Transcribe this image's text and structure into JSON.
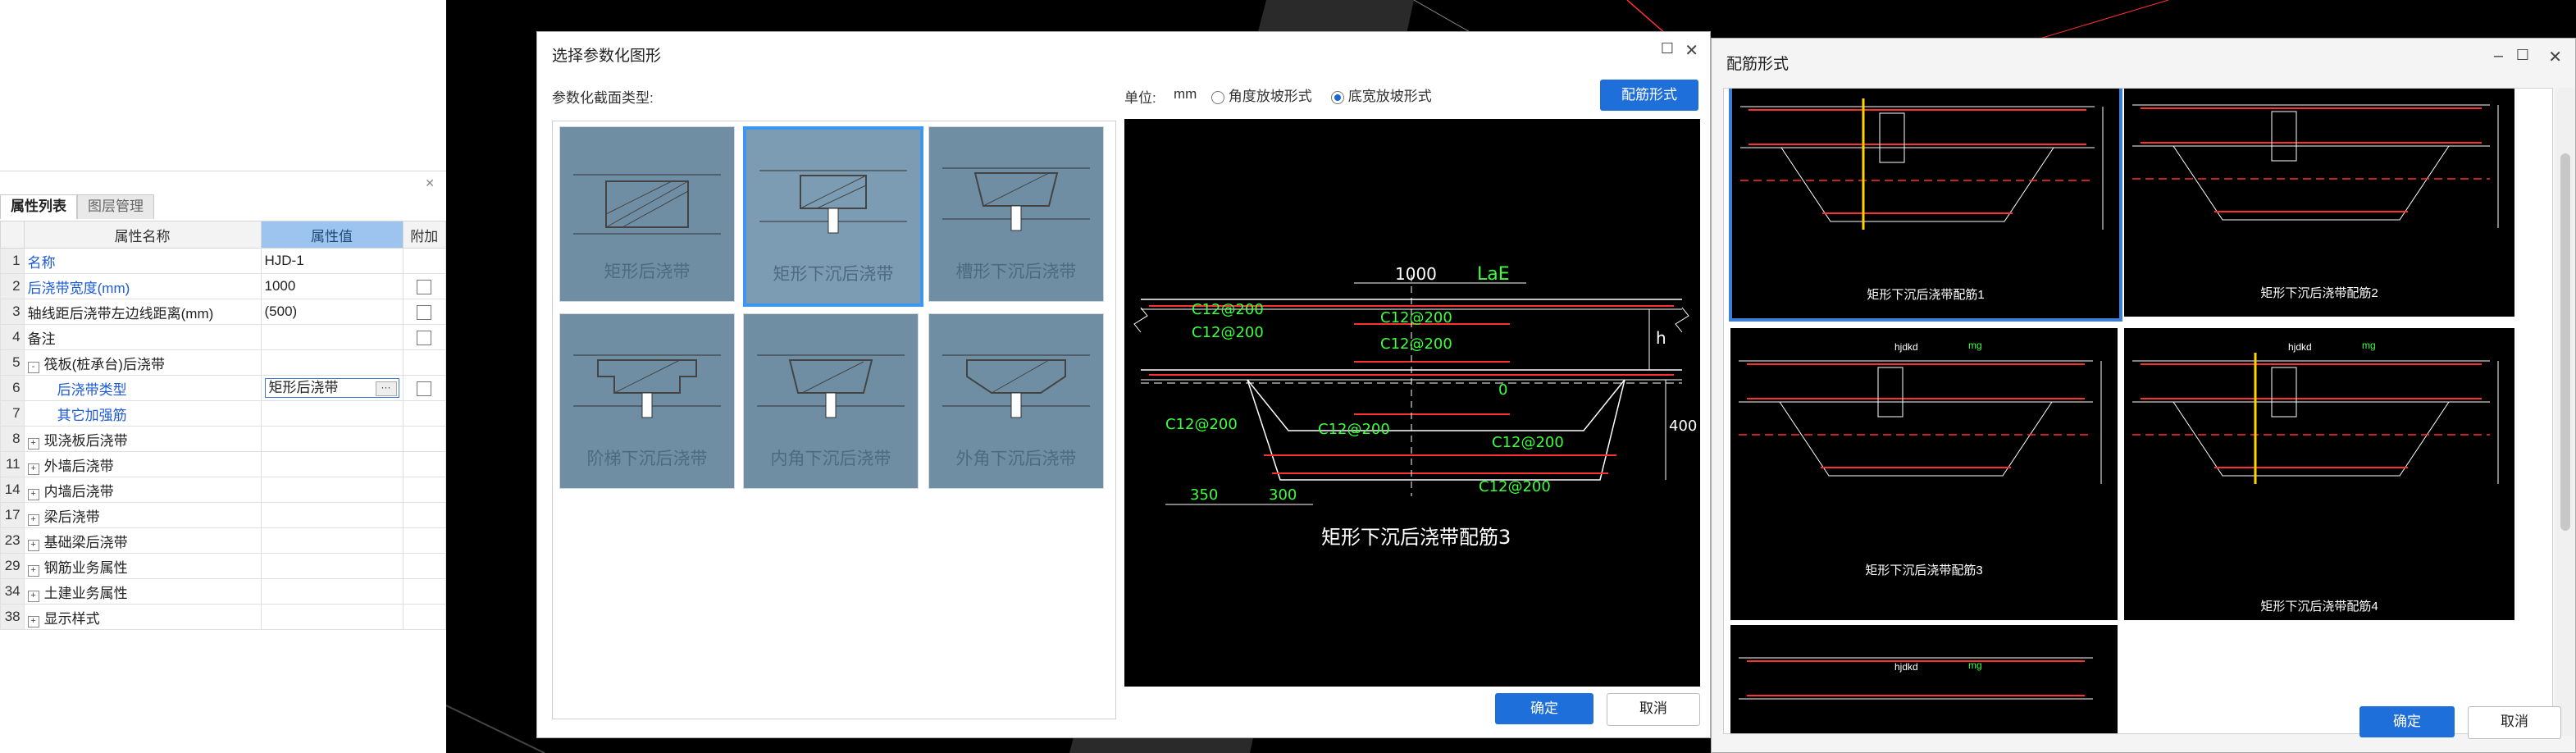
{
  "property_panel": {
    "tabs": [
      "属性列表",
      "图层管理"
    ],
    "headers": {
      "name": "属性名称",
      "value": "属性值",
      "extra": "附加"
    },
    "rows": [
      {
        "num": "1",
        "name": "名称",
        "value": "HJD-1",
        "name_blue": true,
        "check": false
      },
      {
        "num": "2",
        "name": "后浇带宽度(mm)",
        "value": "1000",
        "name_blue": true,
        "check": true
      },
      {
        "num": "3",
        "name": "轴线距后浇带左边线距离(mm)",
        "value": "(500)",
        "name_blue": false,
        "check": true
      },
      {
        "num": "4",
        "name": "备注",
        "value": "",
        "name_blue": false,
        "check": true
      },
      {
        "num": "5",
        "name": "筏板(桩承台)后浇带",
        "value": "",
        "name_blue": false,
        "check": false,
        "expand": "-"
      },
      {
        "num": "6",
        "name": "后浇带类型",
        "value": "矩形后浇带",
        "name_blue": true,
        "check": true,
        "selected": true
      },
      {
        "num": "7",
        "name": "其它加强筋",
        "value": "",
        "name_blue": true,
        "check": false
      },
      {
        "num": "8",
        "name": "现浇板后浇带",
        "value": "",
        "name_blue": false,
        "check": false,
        "expand": "+"
      },
      {
        "num": "11",
        "name": "外墙后浇带",
        "value": "",
        "name_blue": false,
        "check": false,
        "expand": "+"
      },
      {
        "num": "14",
        "name": "内墙后浇带",
        "value": "",
        "name_blue": false,
        "check": false,
        "expand": "+"
      },
      {
        "num": "17",
        "name": "梁后浇带",
        "value": "",
        "name_blue": false,
        "check": false,
        "expand": "+"
      },
      {
        "num": "23",
        "name": "基础梁后浇带",
        "value": "",
        "name_blue": false,
        "check": false,
        "expand": "+"
      },
      {
        "num": "29",
        "name": "钢筋业务属性",
        "value": "",
        "name_blue": false,
        "check": false,
        "expand": "+"
      },
      {
        "num": "34",
        "name": "土建业务属性",
        "value": "",
        "name_blue": false,
        "check": false,
        "expand": "+"
      },
      {
        "num": "38",
        "name": "显示样式",
        "value": "",
        "name_blue": false,
        "check": false,
        "expand": "+"
      }
    ]
  },
  "dialog_shape": {
    "title": "选择参数化图形",
    "section_label": "参数化截面类型:",
    "unit_label": "单位:",
    "unit": "mm",
    "radio_angle": "角度放坡形式",
    "radio_width": "底宽放坡形式",
    "rebar_button": "配筋形式",
    "ok": "确定",
    "cancel": "取消",
    "tiles": [
      "矩形后浇带",
      "矩形下沉后浇带",
      "槽形下沉后浇带",
      "阶梯下沉后浇带",
      "内角下沉后浇带",
      "外角下沉后浇带"
    ],
    "preview": {
      "caption": "矩形下沉后浇带配筋3",
      "dims": {
        "width": "1000",
        "lae": "LaE",
        "h": "h",
        "zero": "0",
        "d400": "400",
        "d350": "350",
        "d300": "300"
      },
      "rebar_labels": [
        "C12@200",
        "C12@200",
        "C12@200",
        "C12@200",
        "C12@200",
        "C12@200",
        "C12@200",
        "C12@200"
      ]
    }
  },
  "dialog_rebar": {
    "title": "配筋形式",
    "ok": "确定",
    "cancel": "取消",
    "tiles": [
      "矩形下沉后浇带配筋1",
      "矩形下沉后浇带配筋2",
      "矩形下沉后浇带配筋3",
      "矩形下沉后浇带配筋4"
    ],
    "top_labels": {
      "hjdkd": "hjdkd",
      "mg": "mg"
    }
  }
}
